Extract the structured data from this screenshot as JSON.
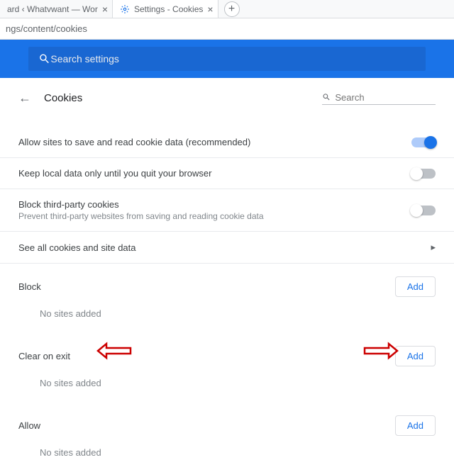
{
  "tabs": [
    {
      "title": "ard ‹ Whatvwant — Wor"
    },
    {
      "title": "Settings - Cookies"
    }
  ],
  "addressbar": "ngs/content/cookies",
  "bluesearch_placeholder": "Search settings",
  "header": {
    "title": "Cookies",
    "search_placeholder": "Search"
  },
  "settings": {
    "allow": "Allow sites to save and read cookie data (recommended)",
    "keeplocal": "Keep local data only until you quit your browser",
    "block3p": "Block third-party cookies",
    "block3p_sub": "Prevent third-party websites from saving and reading cookie data",
    "seeall": "See all cookies and site data"
  },
  "sections": {
    "block": "Block",
    "clear": "Clear on exit",
    "allow": "Allow",
    "addbtn": "Add",
    "empty": "No sites added"
  }
}
